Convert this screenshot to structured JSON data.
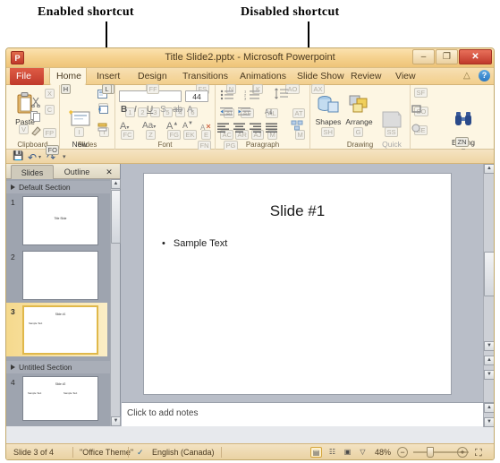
{
  "annotations": [
    {
      "label": "Enabled shortcut",
      "name": "enabled-shortcut-annotation"
    },
    {
      "label": "Disabled shortcut",
      "name": "disabled-shortcut-annotation"
    }
  ],
  "titlebar": {
    "app_icon": "P",
    "title": "Title Slide2.pptx  -  Microsoft Powerpoint",
    "minimize": "–",
    "restore": "❐",
    "close": "✕"
  },
  "tabs": [
    {
      "label": "File",
      "keytip": "",
      "active": false,
      "file": true
    },
    {
      "label": "Home",
      "keytip": "H",
      "active": true,
      "file": false
    },
    {
      "label": "Insert",
      "keytip": "L",
      "active": false,
      "file": false
    },
    {
      "label": "Design",
      "keytip": "FF",
      "active": false,
      "file": false
    },
    {
      "label": "Transitions",
      "keytip": "FS",
      "active": false,
      "file": false
    },
    {
      "label": "Animations",
      "keytip": "U",
      "active": false,
      "file": false
    },
    {
      "label": "Slide Show",
      "keytip": "AX",
      "active": false,
      "file": false
    },
    {
      "label": "Review",
      "keytip": "",
      "active": false,
      "file": false
    },
    {
      "label": "View",
      "keytip": "",
      "active": false,
      "file": false
    }
  ],
  "help_icons": {
    "minimize_ribbon": "△",
    "help": "?"
  },
  "ribbon": {
    "groups": [
      {
        "label": "Clipboard",
        "keytip": "FO"
      },
      {
        "label": "Slides",
        "keytip": ""
      },
      {
        "label": "Font",
        "keytip": "FN"
      },
      {
        "label": "Paragraph",
        "keytip": "PG"
      },
      {
        "label": "Drawing",
        "keytip": ""
      },
      {
        "label": "Editing",
        "keytip": "ZN"
      }
    ],
    "clipboard": {
      "paste_label": "Paste",
      "keytips": {
        "paste": "V",
        "cut": "X",
        "copy": "C",
        "format_painter": "FP"
      }
    },
    "slides": {
      "new_slide_label": "New\nSlide ▾",
      "keytips": {
        "new_slide": "I",
        "layout": "L",
        "reset": "Q",
        "section": "T"
      }
    },
    "font": {
      "size_value": "44",
      "keytips": [
        "1",
        "2",
        "3",
        "5",
        "4",
        "6",
        "FC",
        "Z",
        "FG",
        "EK",
        "E"
      ]
    },
    "paragraph": {
      "keytips": [
        "N",
        "K",
        "AO",
        "AI",
        "AF",
        "AL",
        "AC",
        "AR",
        "AJ",
        "M",
        "AT",
        "AB",
        "AV"
      ]
    },
    "drawing": {
      "shapes_label": "Shapes",
      "arrange_label": "Arrange",
      "quick_styles_label": "Quick\nStyles ▾",
      "keytips": {
        "shapes": "SH",
        "arrange": "G",
        "quick_styles": "SS",
        "shape_fill": "SF",
        "shape_outline": "SO",
        "shape_effects": "SE"
      }
    },
    "editing": {
      "editing_label": "Editing\n▾",
      "keytip": "ZN"
    }
  },
  "qat": {
    "save": "💾",
    "undo": "↶",
    "redo": "↷",
    "keytip": "FO"
  },
  "slides_pane": {
    "tabs": [
      {
        "label": "Slides",
        "selected": true
      },
      {
        "label": "Outline",
        "selected": false
      }
    ],
    "close": "✕",
    "sections": [
      {
        "name": "Default Section",
        "slides": [
          {
            "num": "1",
            "title": "Title Slide",
            "bullets": [],
            "selected": false
          },
          {
            "num": "2",
            "title": "",
            "bullets": [],
            "selected": false
          },
          {
            "num": "3",
            "title": "Slide #1",
            "bullets": [
              "Sample Text"
            ],
            "selected": true
          }
        ]
      },
      {
        "name": "Untitled Section",
        "slides": [
          {
            "num": "4",
            "title": "Slide #2",
            "bullets": [
              "Sample Text",
              "Sample Text"
            ],
            "selected": false
          }
        ]
      }
    ]
  },
  "slide_canvas": {
    "title": "Slide #1",
    "bullet_marker": "•",
    "bullet": "Sample Text"
  },
  "notes": {
    "placeholder": "Click to add notes"
  },
  "status": {
    "slide_count": "Slide 3 of 4",
    "theme": "\"Office Theme\"",
    "spell_icon": "✓",
    "language": "English (Canada)",
    "views": [
      {
        "name": "normal-view",
        "glyph": "▤",
        "selected": true
      },
      {
        "name": "slide-sorter-view",
        "glyph": "☷",
        "selected": false
      },
      {
        "name": "reading-view",
        "glyph": "▣",
        "selected": false
      },
      {
        "name": "slideshow-view",
        "glyph": "▽",
        "selected": false
      }
    ],
    "zoom_level": "48%",
    "zoom_out": "−",
    "zoom_in": "+",
    "fit_window": "⛶"
  }
}
